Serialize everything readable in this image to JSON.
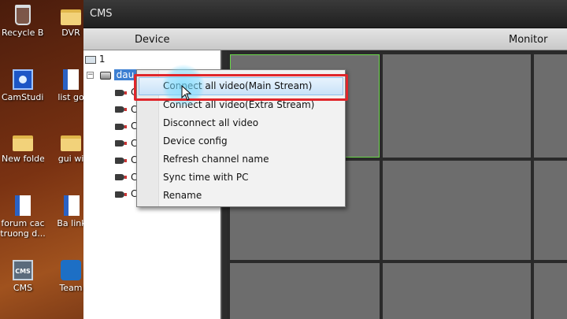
{
  "desktop": {
    "icons": [
      {
        "label": "Recycle Bin",
        "icon": "recycle-bin-icon"
      },
      {
        "label": "DVR",
        "icon": "folder-icon"
      },
      {
        "label": "CamStudio",
        "icon": "camstudio-icon"
      },
      {
        "label": "list go",
        "icon": "document-icon"
      },
      {
        "label": "New folder",
        "icon": "folder-icon"
      },
      {
        "label": "gui wi",
        "icon": "folder-icon"
      },
      {
        "label": "forum cac truong d...",
        "icon": "word-document-icon"
      },
      {
        "label": "Ba link",
        "icon": "word-document-icon"
      },
      {
        "label": "CMS",
        "icon": "cms-icon"
      },
      {
        "label": "Team",
        "icon": "teamviewer-icon"
      }
    ]
  },
  "window": {
    "title": "CMS",
    "device_header": "Device",
    "monitor_header": "Monitor"
  },
  "tree": {
    "root_label": "1",
    "expander": "−",
    "device_label": "dau",
    "channel_prefix": "C",
    "channel_count": 7
  },
  "context_menu": {
    "items": [
      "Connect all video(Main Stream)",
      "Connect all video(Extra Stream)",
      "Disconnect all video",
      "Device config",
      "Refresh channel name",
      "Sync time with PC",
      "Rename"
    ],
    "highlighted_index": 0
  },
  "colors": {
    "highlight_box": "#e0262b",
    "active_cell_border": "#6bd84a",
    "selection": "#3c7fd2"
  }
}
